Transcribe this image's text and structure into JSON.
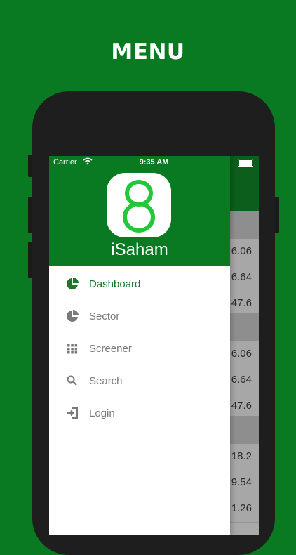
{
  "headline": "MENU",
  "status_bar": {
    "carrier": "Carrier",
    "time": "9:35 AM"
  },
  "drawer": {
    "app_name": "iSaham",
    "items": [
      {
        "label": "Dashboard",
        "icon": "pie-chart-icon",
        "active": true
      },
      {
        "label": "Sector",
        "icon": "pie-chart-icon",
        "active": false
      },
      {
        "label": "Screener",
        "icon": "grid-icon",
        "active": false
      },
      {
        "label": "Search",
        "icon": "search-icon",
        "active": false
      },
      {
        "label": "Login",
        "icon": "login-icon",
        "active": false
      }
    ]
  },
  "background_values": [
    "6.06",
    "6.64",
    "47.6",
    "6.06",
    "6.64",
    "47.6",
    "18.2",
    "9.54",
    "1.26"
  ],
  "colors": {
    "brand_green": "#0a7a22",
    "active_text": "#1a7a2a",
    "inactive_text": "#7a7a7a"
  }
}
